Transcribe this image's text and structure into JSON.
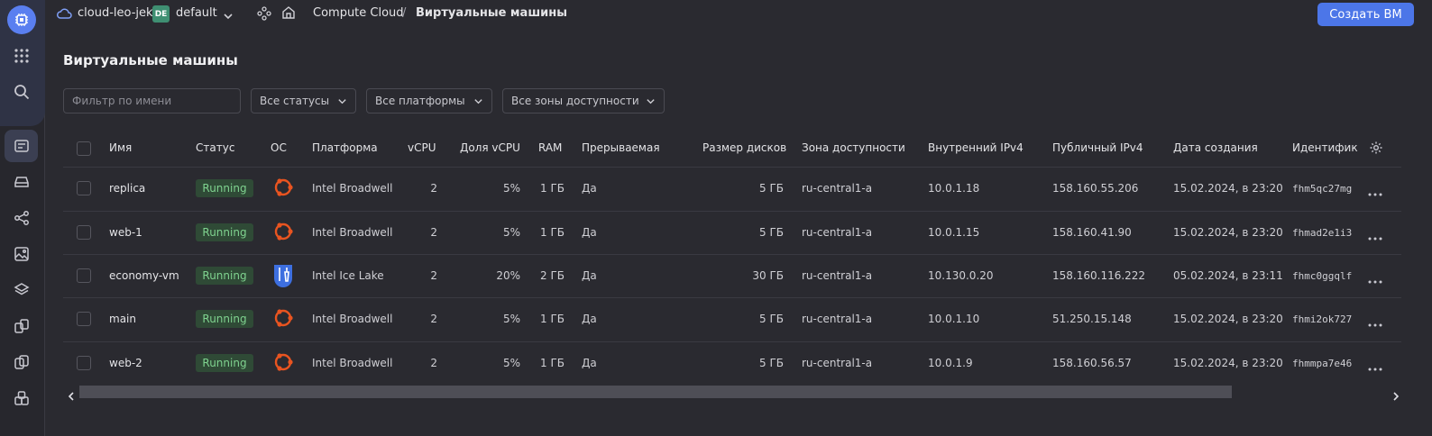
{
  "header": {
    "cloud_name": "cloud-leo-jek",
    "folder_badge": "DE",
    "folder_name": "default",
    "breadcrumb_service": "Compute Cloud",
    "breadcrumb_separator": "/",
    "breadcrumb_current": "Виртуальные машины",
    "create_button": "Создать ВМ"
  },
  "page": {
    "title": "Виртуальные машины"
  },
  "filters": {
    "name_placeholder": "Фильтр по имени",
    "status": "Все статусы",
    "platform": "Все платформы",
    "zone": "Все зоны доступности"
  },
  "table": {
    "columns": [
      "Имя",
      "Статус",
      "ОС",
      "Платформа",
      "vCPU",
      "Доля vCPU",
      "RAM",
      "Прерываемая",
      "Размер дисков",
      "Зона доступности",
      "Внутренний IPv4",
      "Публичный IPv4",
      "Дата создания",
      "Идентифик"
    ],
    "rows": [
      {
        "name": "replica",
        "status": "Running",
        "os": "ubuntu-icon",
        "platform": "Intel Broadwell",
        "vcpu": "2",
        "share": "5%",
        "ram": "1 ГБ",
        "preemptible": "Да",
        "disk": "5 ГБ",
        "zone": "ru-central1-a",
        "ip_int": "10.0.1.18",
        "ip_pub": "158.160.55.206",
        "created": "15.02.2024, в 23:20",
        "id": "fhm5qc27mg"
      },
      {
        "name": "web-1",
        "status": "Running",
        "os": "ubuntu-icon",
        "platform": "Intel Broadwell",
        "vcpu": "2",
        "share": "5%",
        "ram": "1 ГБ",
        "preemptible": "Да",
        "disk": "5 ГБ",
        "zone": "ru-central1-a",
        "ip_int": "10.0.1.15",
        "ip_pub": "158.160.41.90",
        "created": "15.02.2024, в 23:20",
        "id": "fhmad2e1i3"
      },
      {
        "name": "economy-vm",
        "status": "Running",
        "os": "tools-icon",
        "platform": "Intel Ice Lake",
        "vcpu": "2",
        "share": "20%",
        "ram": "2 ГБ",
        "preemptible": "Да",
        "disk": "30 ГБ",
        "zone": "ru-central1-a",
        "ip_int": "10.130.0.20",
        "ip_pub": "158.160.116.222",
        "created": "05.02.2024, в 23:11",
        "id": "fhmc0ggqlf"
      },
      {
        "name": "main",
        "status": "Running",
        "os": "ubuntu-icon",
        "platform": "Intel Broadwell",
        "vcpu": "2",
        "share": "5%",
        "ram": "1 ГБ",
        "preemptible": "Да",
        "disk": "5 ГБ",
        "zone": "ru-central1-a",
        "ip_int": "10.0.1.10",
        "ip_pub": "51.250.15.148",
        "created": "15.02.2024, в 23:20",
        "id": "fhmi2ok727"
      },
      {
        "name": "web-2",
        "status": "Running",
        "os": "ubuntu-icon",
        "platform": "Intel Broadwell",
        "vcpu": "2",
        "share": "5%",
        "ram": "1 ГБ",
        "preemptible": "Да",
        "disk": "5 ГБ",
        "zone": "ru-central1-a",
        "ip_int": "10.0.1.9",
        "ip_pub": "158.160.56.57",
        "created": "15.02.2024, в 23:20",
        "id": "fhmmpa7e46"
      }
    ]
  },
  "colors": {
    "accent": "#4c76e8",
    "status_bg": "#2f4a36",
    "status_text": "#7fd38f",
    "ubuntu": "#e95420"
  }
}
